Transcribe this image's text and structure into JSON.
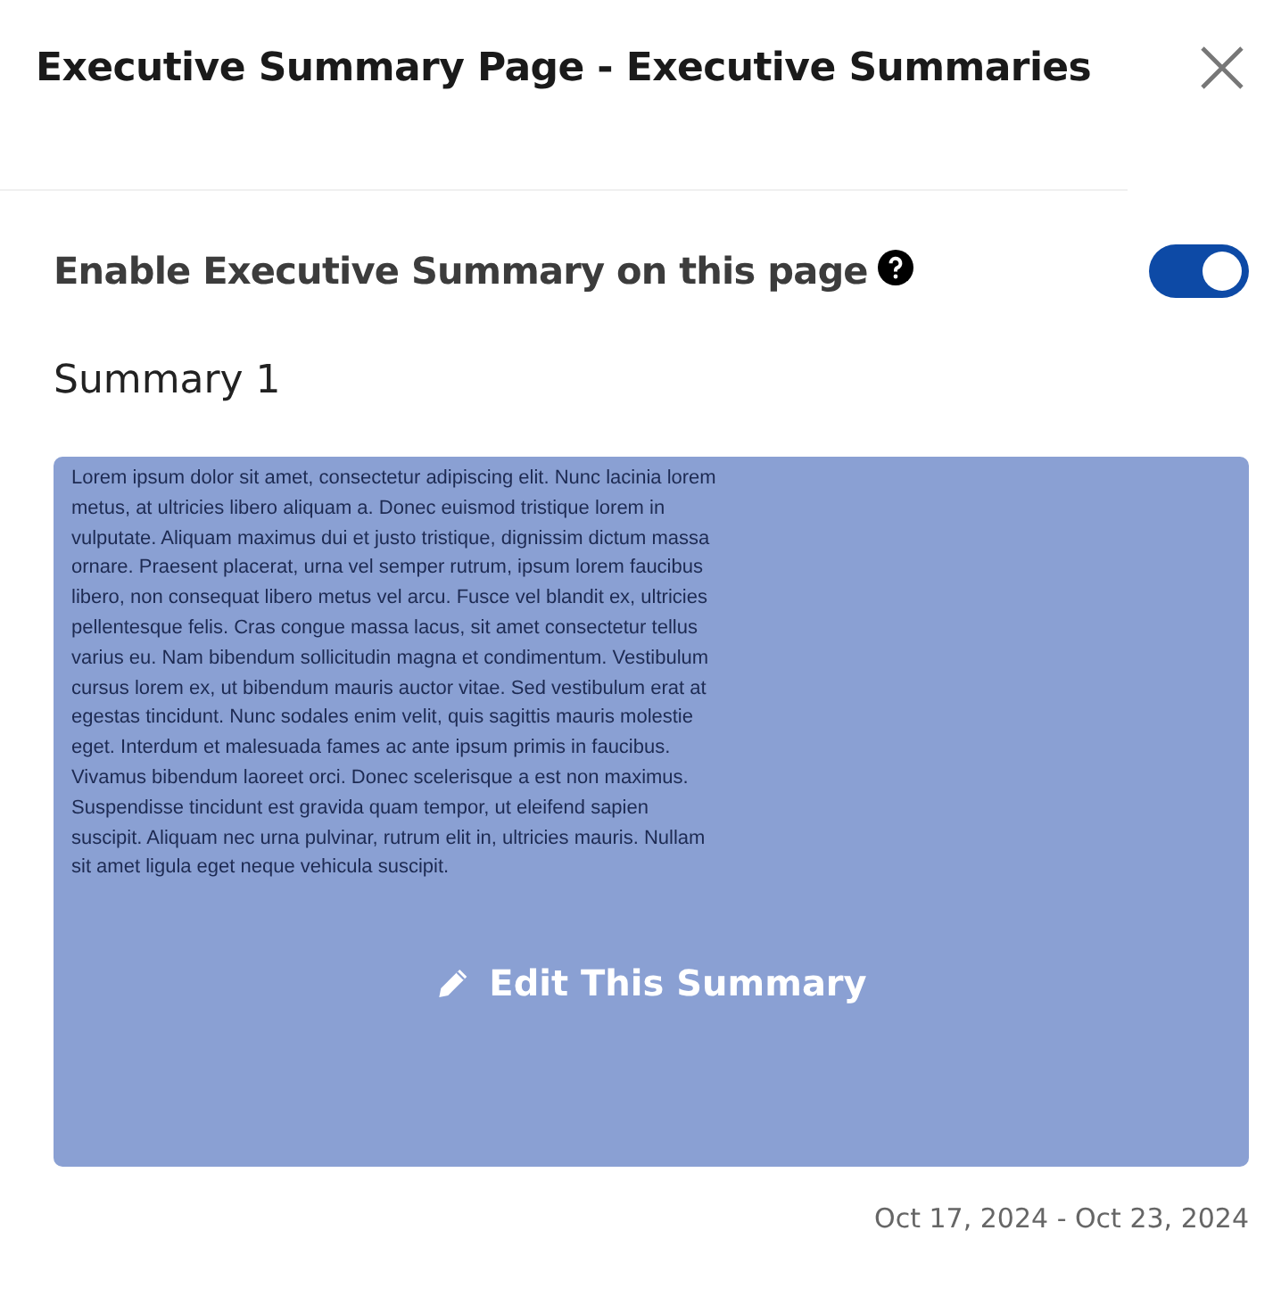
{
  "dialog": {
    "title": "Executive Summary Page - Executive Summaries"
  },
  "enable_setting": {
    "label": "Enable Executive Summary on this page",
    "on": true
  },
  "summaries": [
    {
      "heading": "Summary 1",
      "text": "Lorem ipsum dolor sit amet, consectetur adipiscing elit. Nunc lacinia lorem metus, at ultricies libero aliquam a. Donec euismod tristique lorem in vulputate. Aliquam maximus dui et justo tristique, dignissim dictum massa ornare. Praesent placerat, urna vel semper rutrum, ipsum lorem faucibus libero, non consequat libero metus vel arcu. Fusce vel blandit ex, ultricies pellentesque felis. Cras congue massa lacus, sit amet consectetur tellus varius eu. Nam bibendum sollicitudin magna et condimentum. Vestibulum cursus lorem ex, ut bibendum mauris auctor vitae. Sed vestibulum erat at egestas tincidunt. Nunc sodales enim velit, quis sagittis mauris molestie eget. Interdum et malesuada fames ac ante ipsum primis in faucibus. Vivamus bibendum laoreet orci. Donec scelerisque a est non maximus. Suspendisse tincidunt est gravida quam tempor, ut eleifend sapien suscipit. Aliquam nec urna pulvinar, rutrum elit in, ultricies mauris. Nullam sit amet ligula eget neque vehicula suscipit.",
      "edit_label": "Edit This Summary",
      "date_range": "Oct 17, 2024 - Oct 23, 2024"
    }
  ]
}
